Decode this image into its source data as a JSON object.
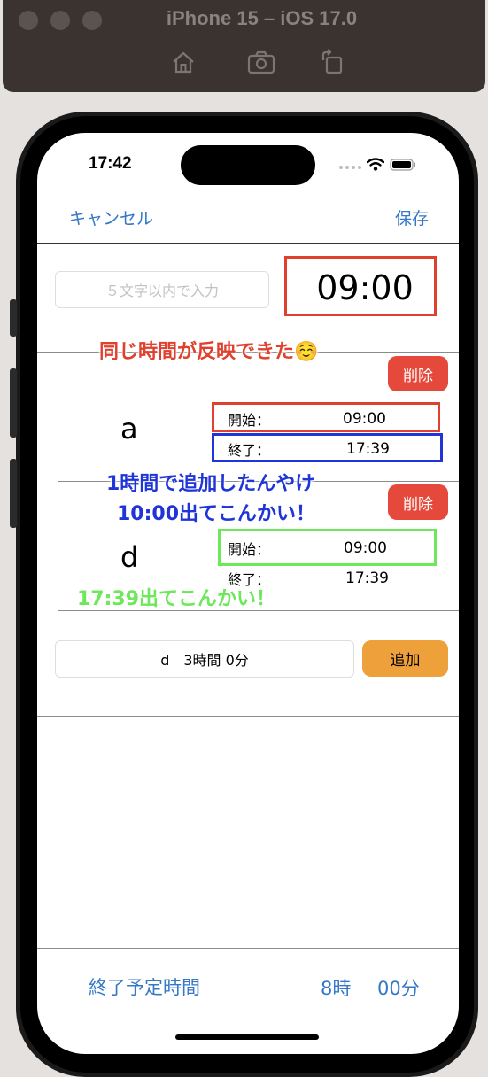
{
  "simulator": {
    "title": "iPhone 15 – iOS 17.0",
    "buttons": [
      {
        "icon": "home-icon"
      },
      {
        "icon": "screenshot-icon"
      },
      {
        "icon": "rotate-icon"
      }
    ]
  },
  "status_bar": {
    "time": "17:42"
  },
  "nav": {
    "cancel_label": "キャンセル",
    "save_label": "保存"
  },
  "header": {
    "name_placeholder": "５文字以内で入力",
    "start_time": "09:00"
  },
  "annotations": {
    "note1": "同じ時間が反映できた☺️",
    "note2_line1": "1時間で追加したんやけ",
    "note2_line2": "10:00出てこんかい！",
    "note3": "17:39出てこんかい！"
  },
  "rows": [
    {
      "name": "a",
      "delete_label": "削除",
      "start_label": "開始：",
      "start_value": "09:00",
      "end_label": "終了：",
      "end_value": "17:39"
    },
    {
      "name": "d",
      "delete_label": "削除",
      "start_label": "開始：",
      "start_value": "09:00",
      "end_label": "終了：",
      "end_value": "17:39"
    }
  ],
  "add_form": {
    "input_value": "d　3時間 0分",
    "add_label": "追加"
  },
  "footer": {
    "label": "終了予定時間",
    "hours": "8時",
    "minutes": "00分"
  },
  "colors": {
    "accent": "#3478c6",
    "delete": "#e4493c",
    "add": "#eea03a",
    "annotation_red": "#e0412f",
    "annotation_blue": "#2035d8",
    "annotation_green": "#6de85a"
  }
}
